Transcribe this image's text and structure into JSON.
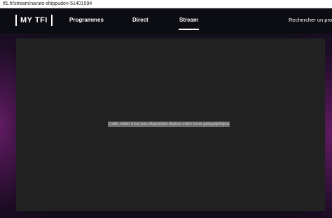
{
  "browser": {
    "url": "tf1.fr/stream/naruto-shippuden-51401594"
  },
  "header": {
    "logo": "MY TFI",
    "nav": {
      "programmes": "Programmes",
      "direct": "Direct",
      "stream": "Stream",
      "active": "Stream"
    },
    "search_label": "Rechercher un progra"
  },
  "player": {
    "message": "Cette vidéo n'est pas disponible depuis votre zone géographique"
  },
  "colors": {
    "accent": "#ffffff",
    "player_bg": "#212121",
    "side_glow": "#6e1e6e"
  }
}
